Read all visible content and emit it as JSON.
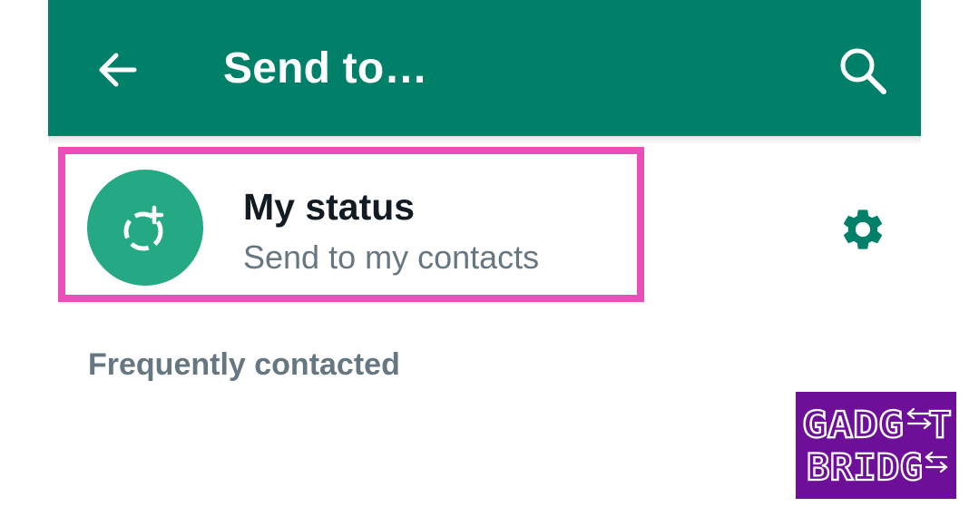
{
  "toolbar": {
    "title": "Send to…",
    "back_icon": "arrow-back-icon",
    "search_icon": "search-icon",
    "background_color": "#008069"
  },
  "status": {
    "title": "My status",
    "subtitle": "Send to my contacts",
    "avatar_icon": "add-status-icon",
    "avatar_color": "#25a884",
    "settings_icon": "gear-icon",
    "settings_color": "#008069"
  },
  "highlight_color": "#e84fb8",
  "section": {
    "frequently_contacted": "Frequently contacted"
  },
  "watermark": {
    "line1": "GADGET",
    "line2": "BRIDGE",
    "background_color": "#6e0f99"
  }
}
